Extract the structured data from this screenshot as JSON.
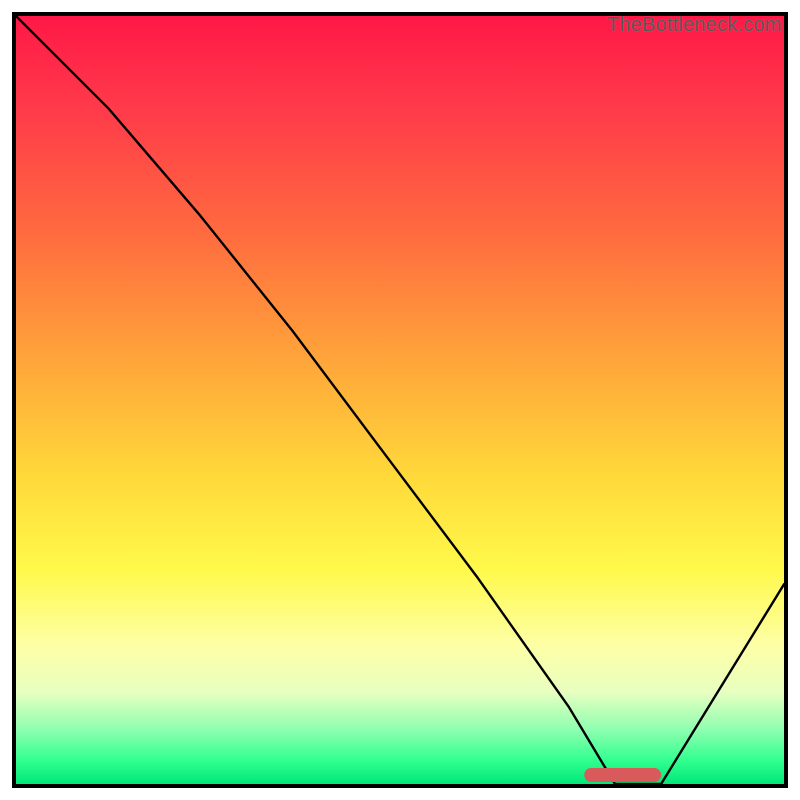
{
  "watermark": "TheBottleneck.com",
  "colors": {
    "gradient_top": "#ff1847",
    "gradient_mid": "#ffd93a",
    "gradient_bottom": "#00e87a",
    "curve": "#000000",
    "marker": "#d85a5a",
    "frame": "#000000"
  },
  "chart_data": {
    "type": "line",
    "title": "",
    "xlabel": "",
    "ylabel": "",
    "xlim": [
      0,
      100
    ],
    "ylim": [
      0,
      100
    ],
    "grid": false,
    "legend": false,
    "annotations": [
      "TheBottleneck.com"
    ],
    "series": [
      {
        "name": "bottleneck-curve",
        "x": [
          0,
          12,
          24,
          36,
          48,
          60,
          72,
          78,
          84,
          100
        ],
        "y": [
          100,
          88,
          74,
          59,
          43,
          27,
          10,
          0,
          0,
          26
        ]
      }
    ],
    "marker": {
      "name": "optimal-range",
      "x_start": 74,
      "x_end": 84,
      "y": 0,
      "shape": "rounded-bar"
    },
    "background": {
      "type": "vertical-gradient",
      "stops": [
        {
          "pos": 0.0,
          "color": "#ff1847"
        },
        {
          "pos": 0.12,
          "color": "#ff3a4a"
        },
        {
          "pos": 0.28,
          "color": "#ff6a3f"
        },
        {
          "pos": 0.44,
          "color": "#ffa23a"
        },
        {
          "pos": 0.6,
          "color": "#ffd93a"
        },
        {
          "pos": 0.72,
          "color": "#fff94a"
        },
        {
          "pos": 0.82,
          "color": "#fdffa6"
        },
        {
          "pos": 0.88,
          "color": "#e8ffc0"
        },
        {
          "pos": 0.93,
          "color": "#8dffb0"
        },
        {
          "pos": 0.97,
          "color": "#2fff8f"
        },
        {
          "pos": 1.0,
          "color": "#00e87a"
        }
      ]
    }
  }
}
